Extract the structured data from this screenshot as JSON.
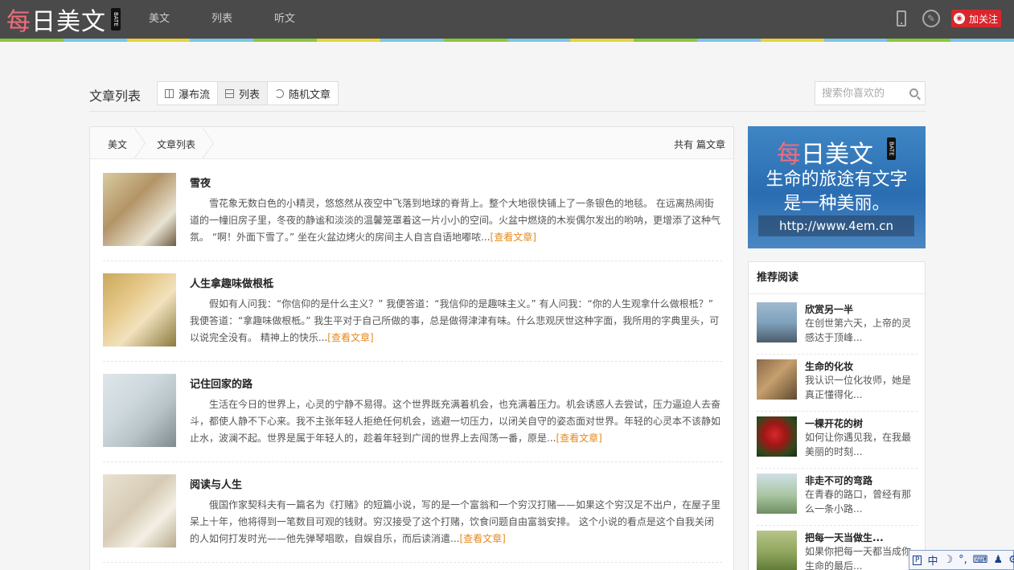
{
  "topbar": {
    "logo_text": "每日美文",
    "logo_beta": "BATE",
    "nav": [
      "美文",
      "列表",
      "听文"
    ],
    "follow_label": "加关注",
    "icons": [
      "phone-icon",
      "edit-icon",
      "weibo-icon"
    ]
  },
  "colors": {
    "topbar_bg": "#4a4a4a",
    "accent_more": "#e58a1f",
    "follow_red": "#d8262c",
    "color_strip": [
      "#8cc63f",
      "#7cc4e4",
      "#e6d23b",
      "#7cc4e4",
      "#8cc63f",
      "#e6d23b",
      "#7cc4e4",
      "#8cc63f",
      "#7cc4e4",
      "#e6d23b",
      "#8cc63f",
      "#7cc4e4",
      "#e6d23b",
      "#7cc4e4",
      "#8cc63f",
      "#7cc4e4"
    ]
  },
  "page": {
    "title": "文章列表",
    "view_tabs": [
      "瀑布流",
      "列表",
      "随机文章"
    ],
    "search_placeholder": "搜索你喜欢的"
  },
  "breadcrumb": [
    "美文",
    "文章列表"
  ],
  "total_label": "共有 篇文章",
  "articles": [
    {
      "title": "雪夜",
      "excerpt": "雪花象无数白色的小精灵，悠悠然从夜空中飞落到地球的脊背上。整个大地很快铺上了一条银色的地毯。 在远离热闹街道的一幢旧房子里，冬夜的静谧和淡淡的温馨笼罩着这一片小小的空间。火盆中燃烧的木炭偶尔发出的哟呐，更增添了这种气氛。 “啊！外面下雪了。” 坐在火盆边烤火的房间主人自言自语地嘟哝...",
      "more": "[查看文章]"
    },
    {
      "title": "人生拿趣味做根柢",
      "excerpt": "假如有人问我：“你信仰的是什么主义？” 我便答道：“我信仰的是趣味主义。” 有人问我：“你的人生观拿什么做根柢？” 我便答道：“拿趣味做根柢。” 我生平对于自己所做的事，总是做得津津有味。什么悲观厌世这种字面，我所用的字典里头，可以说完全没有。 精神上的快乐...",
      "more": "[查看文章]"
    },
    {
      "title": "记住回家的路",
      "excerpt": "生活在今日的世界上，心灵的宁静不易得。这个世界既充满着机会，也充满着压力。机会诱惑人去尝试，压力逼迫人去奋斗，都使人静不下心来。我不主张年轻人拒绝任何机会，逃避一切压力，以闭关自守的姿态面对世界。年轻的心灵本不该静如止水，波澜不起。世界是属于年轻人的，趁着年轻到广阔的世界上去闯荡一番，原是...",
      "more": "[查看文章]"
    },
    {
      "title": "阅读与人生",
      "excerpt": "俄国作家契科夫有一篇名为《打赌》的短篇小说，写的是一个富翁和一个穷汉打赌——如果这个穷汉足不出户，在屋子里呆上十年，他将得到一笔数目可观的钱财。穷汉接受了这个打赌，饮食问题自由富翁安排。 这个小说的看点是这个自我关闭的人如何打发时光——他先弹琴唱歌，自娱自乐，而后读消遣...",
      "more": "[查看文章]"
    }
  ],
  "banner": {
    "logo_text": "每日美文",
    "beta": "BATE",
    "line1": "生命的旅途有文字",
    "line2": "是一种美丽。",
    "url": "http://www.4em.cn"
  },
  "recommend": {
    "heading": "推荐阅读",
    "items": [
      {
        "title": "欣赏另一半",
        "desc": "在创世第六天，上帝的灵感达于顶峰..."
      },
      {
        "title": "生命的化妆",
        "desc": "我认识一位化妆师，她是真正懂得化..."
      },
      {
        "title": "一棵开花的树",
        "desc": "如何让你遇见我，在我最美丽的时刻..."
      },
      {
        "title": "非走不可的弯路",
        "desc": "在青春的路口，曾经有那么一条小路..."
      },
      {
        "title": "把每一天当做生...",
        "desc": "如果你把每一天都当成你生命的最后..."
      }
    ]
  },
  "ime": [
    "中",
    "☽",
    "°,",
    "⌨",
    "♟",
    "⚙"
  ]
}
